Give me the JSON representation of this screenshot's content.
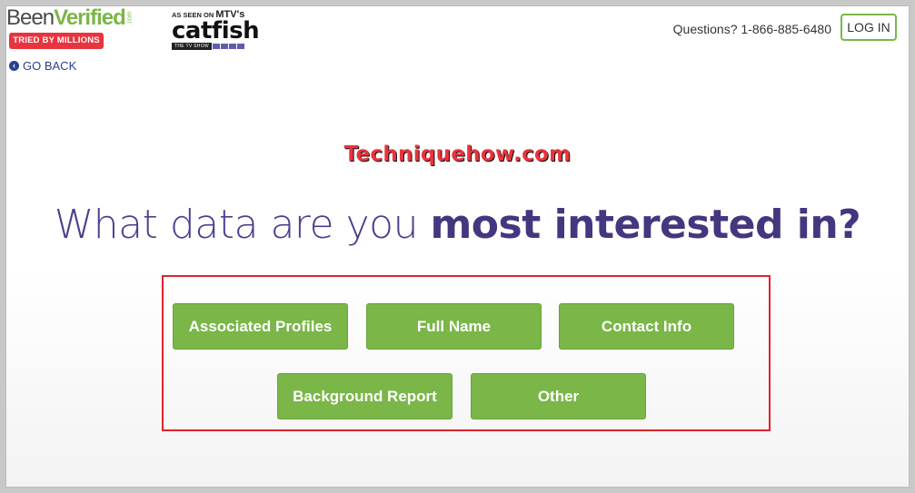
{
  "header": {
    "logo_been": "Been",
    "logo_verified": "Verified",
    "logo_com": ".com",
    "tried_badge": "TRIED BY MILLIONS",
    "as_seen_on": "AS SEEN ON",
    "mtv": "MTV's",
    "catfish": "catfish",
    "tv_show": "THE TV SHOW",
    "questions": "Questions? 1-866-885-6480",
    "login_label": "LOG IN",
    "go_back_label": "GO BACK"
  },
  "watermark": "Techniquehow.com",
  "headline": {
    "light": "What data are you ",
    "bold": "most interested in?"
  },
  "options": [
    {
      "label": "Associated Profiles"
    },
    {
      "label": "Full Name"
    },
    {
      "label": "Contact Info"
    },
    {
      "label": "Background Report"
    },
    {
      "label": "Other"
    }
  ],
  "colors": {
    "accent_green": "#7ab648",
    "headline_purple": "#45367f",
    "badge_red": "#e8343e",
    "link_blue": "#2c3e8f"
  }
}
